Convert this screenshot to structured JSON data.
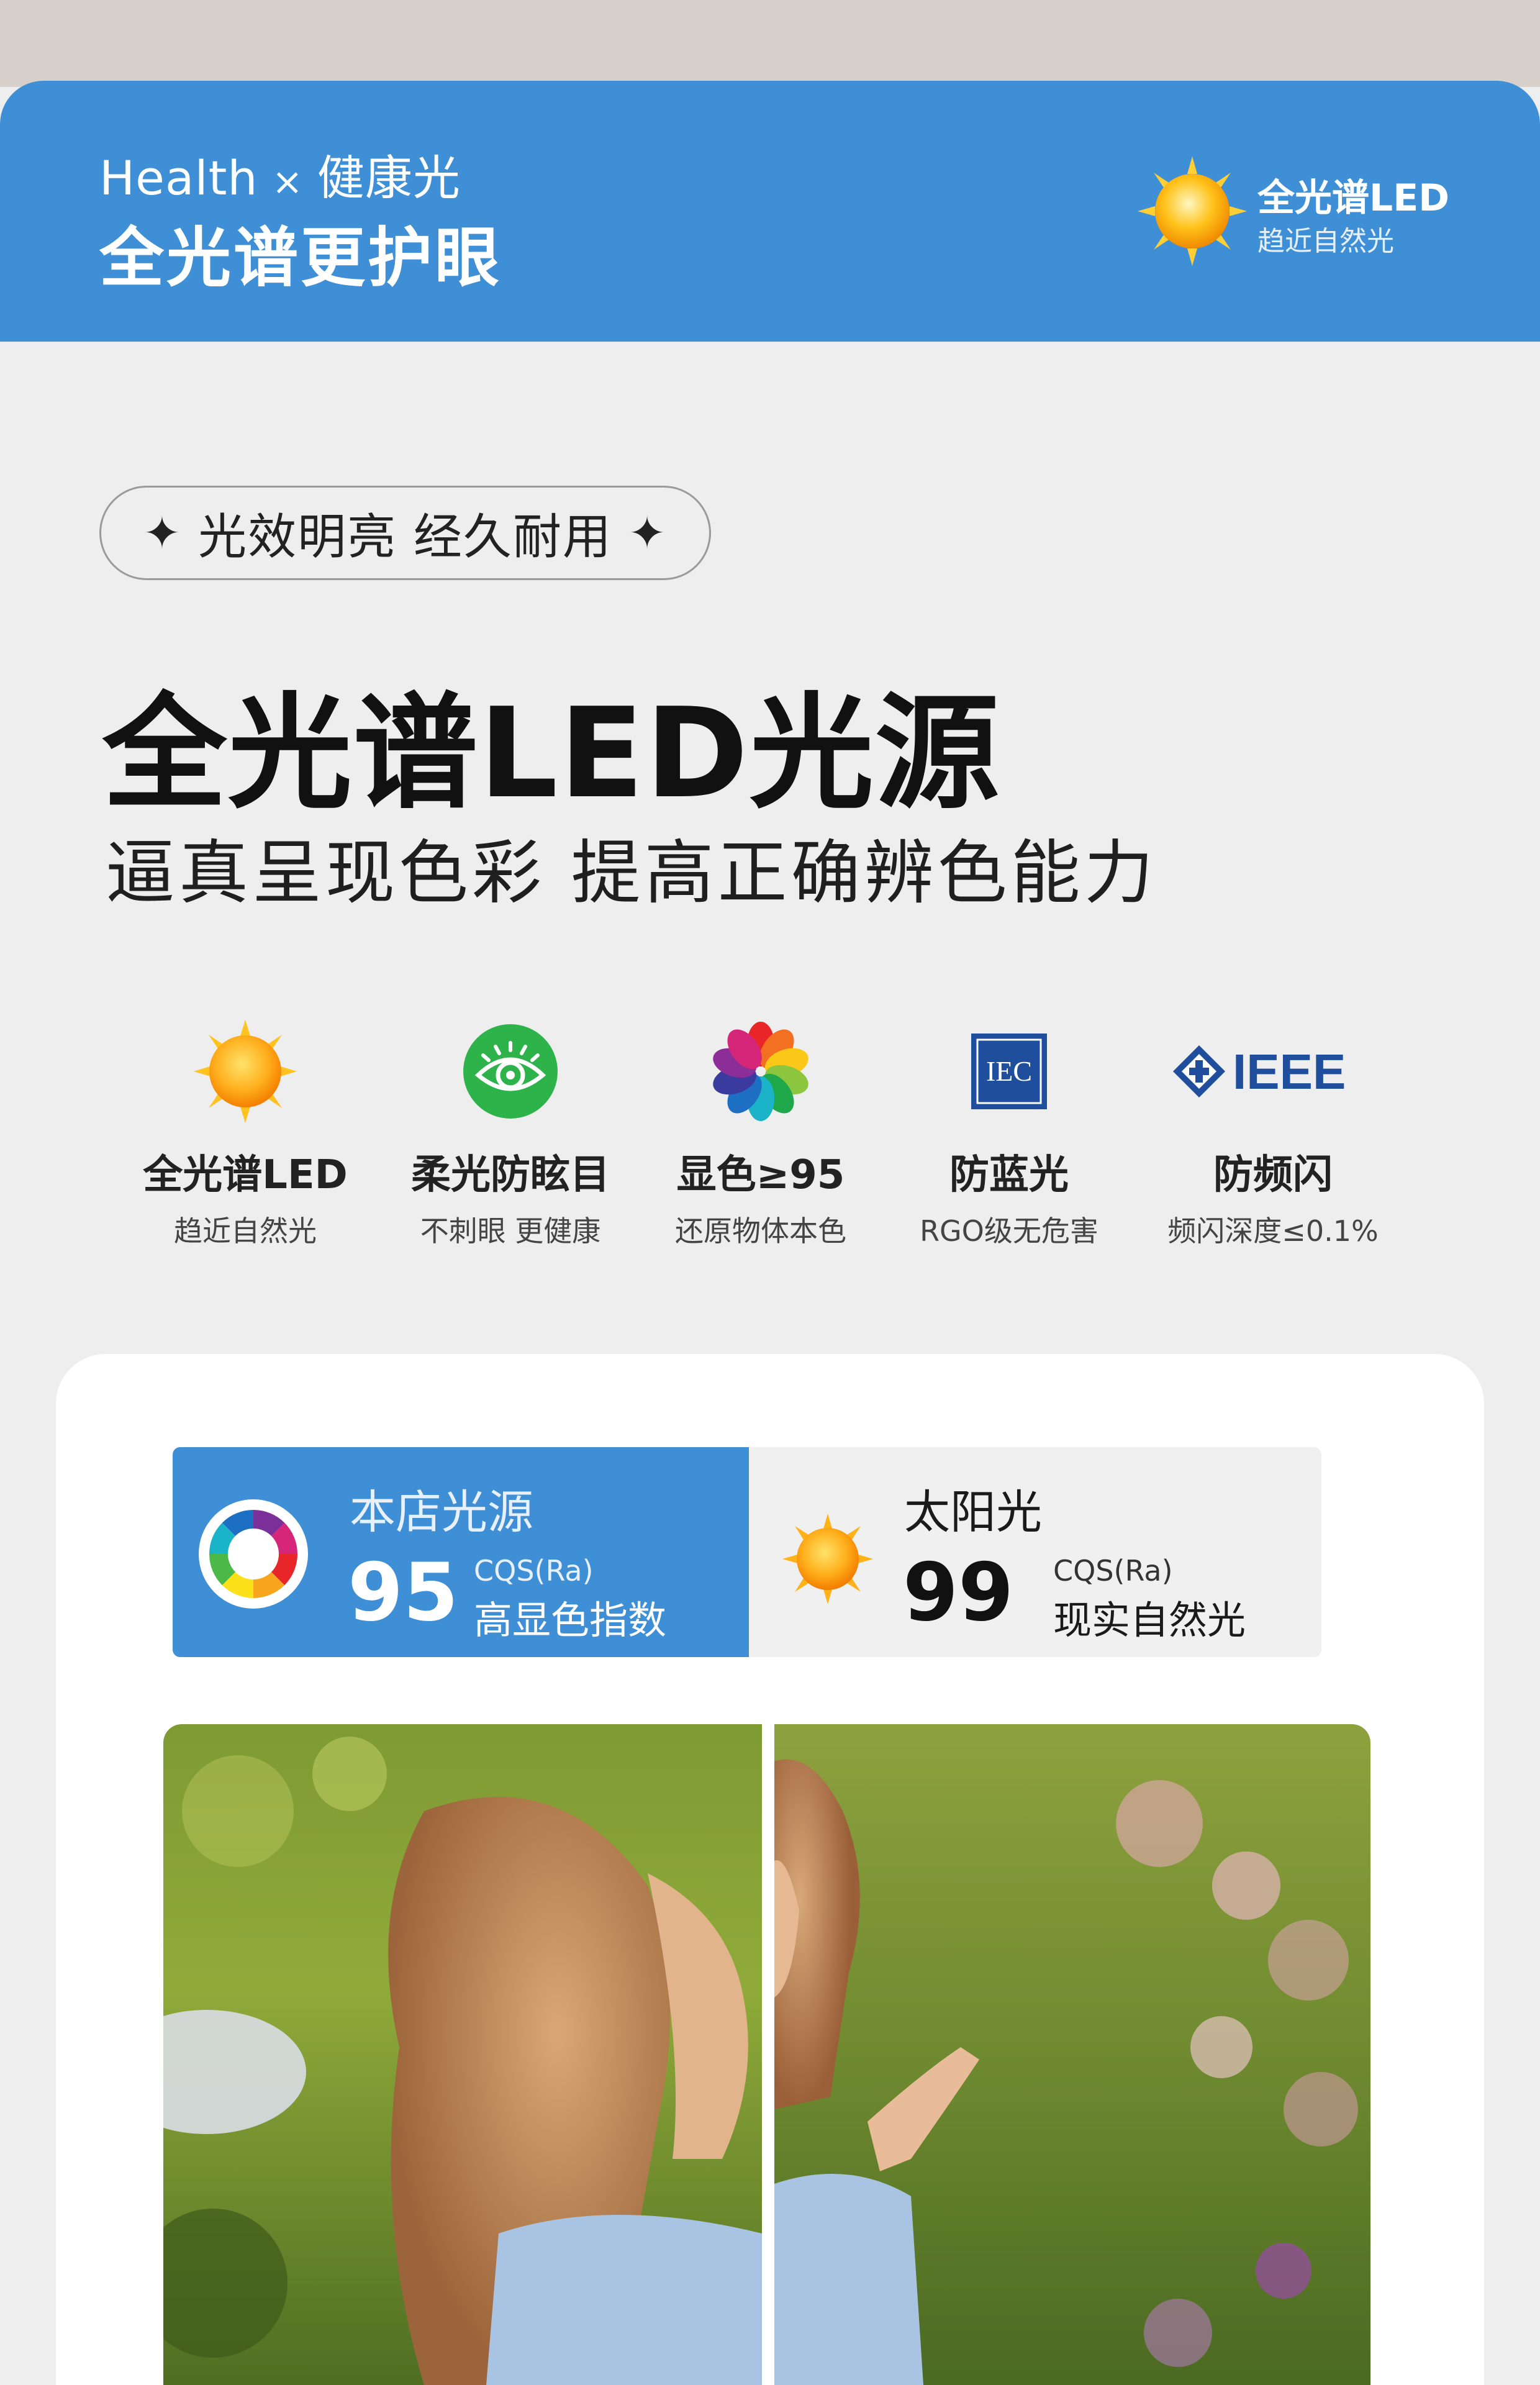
{
  "header": {
    "subtitle_en": "Health",
    "times": "×",
    "subtitle_cn": "健康光",
    "title": "全光谱更护眼",
    "badge_title": "全光谱LED",
    "badge_sub": "趋近自然光"
  },
  "pill": {
    "star": "✦",
    "text": "光效明亮 经久耐用"
  },
  "main": {
    "title": "全光谱LED光源",
    "subtitle": "逼真呈现色彩 提高正确辨色能力"
  },
  "features": [
    {
      "icon": "sun-icon",
      "label": "全光谱LED",
      "sub": "趋近自然光"
    },
    {
      "icon": "eye-icon",
      "label": "柔光防眩目",
      "sub": "不刺眼 更健康"
    },
    {
      "icon": "color-wheel-icon",
      "label": "显色≥95",
      "sub": "还原物体本色"
    },
    {
      "icon": "iec-logo-icon",
      "logo_text": "IEC",
      "label": "防蓝光",
      "sub": "RGO级无危害"
    },
    {
      "icon": "ieee-logo-icon",
      "logo_text": "IEEE",
      "label": "防频闪",
      "sub": "频闪深度≤0.1%"
    }
  ],
  "comparison": {
    "left": {
      "title": "本店光源",
      "value": "95",
      "metric": "CQS(Ra)",
      "desc": "高显色指数"
    },
    "right": {
      "title": "太阳光",
      "value": "99",
      "metric": "CQS(Ra)",
      "desc": "现实自然光"
    }
  },
  "colors": {
    "brand_blue": "#3f8fd6",
    "background": "#eeeeef",
    "sun_orange": "#f7a51c",
    "eye_green": "#2db34a",
    "iec_blue": "#1f4e9c"
  }
}
